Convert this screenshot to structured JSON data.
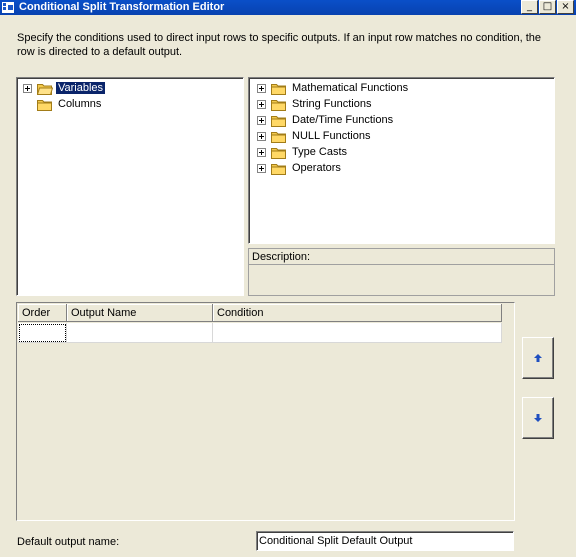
{
  "window": {
    "title": "Conditional Split Transformation Editor",
    "controls": [
      "_",
      "□",
      "×"
    ]
  },
  "instructions": "Specify the conditions used to direct input rows to specific outputs. If an input row matches no condition, the row is directed to a default output.",
  "columns_tree": {
    "items": [
      {
        "label": "Variables",
        "expandable": true,
        "selected": true
      },
      {
        "label": "Columns",
        "expandable": false,
        "selected": false
      }
    ]
  },
  "functions_tree": {
    "items": [
      {
        "label": "Mathematical Functions"
      },
      {
        "label": "String Functions"
      },
      {
        "label": "Date/Time Functions"
      },
      {
        "label": "NULL Functions"
      },
      {
        "label": "Type Casts"
      },
      {
        "label": "Operators"
      }
    ]
  },
  "description_panel": {
    "header": "Description:"
  },
  "conditions_grid": {
    "headers": [
      "Order",
      "Output Name",
      "Condition"
    ]
  },
  "side_buttons": {
    "up_icon": "arrow-up-icon",
    "down_icon": "arrow-down-icon"
  },
  "default_output": {
    "label": "Default output name:",
    "value": "Conditional Split Default Output"
  },
  "colors": {
    "titlebar": "#0a4fc8",
    "selection": "#0a246a",
    "dialog_bg": "#ece9d8",
    "folder": "#f2c94c",
    "arrow": "#1f4fc0"
  }
}
